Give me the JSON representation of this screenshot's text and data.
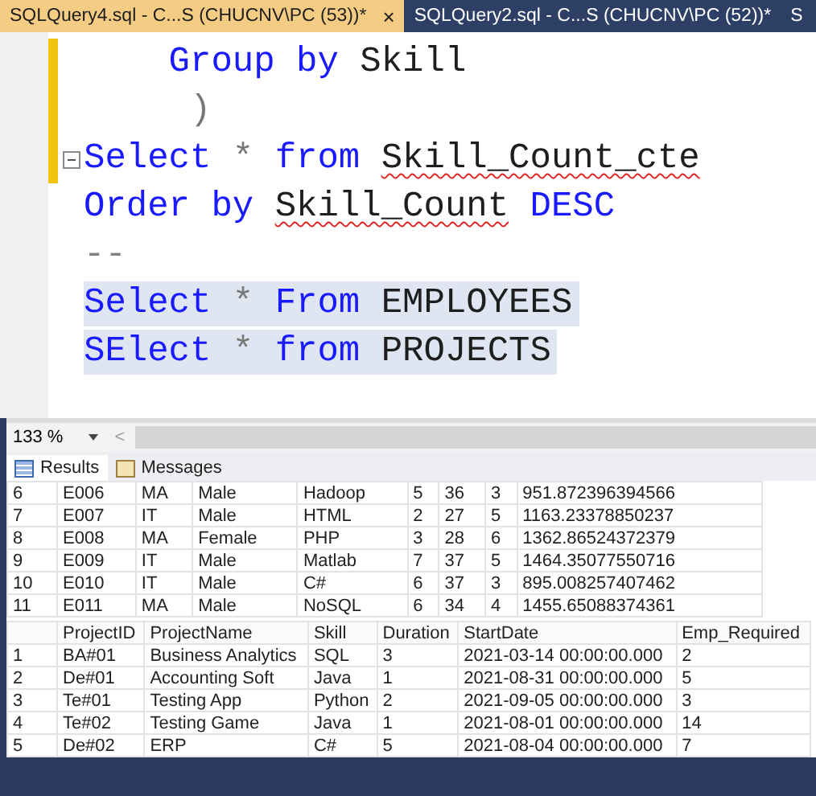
{
  "tabs": [
    {
      "label": "SQLQuery4.sql - C...S (CHUCNV\\PC (53))*",
      "selected": true,
      "close": "×"
    },
    {
      "label": "SQLQuery2.sql - C...S (CHUCNV\\PC (52))*",
      "selected": false
    },
    {
      "label": "S",
      "selected": false
    }
  ],
  "editor": {
    "lines": [
      {
        "selected": false,
        "collapsible": false,
        "tokens": [
          {
            "kind": "keyword",
            "text": "    Group by"
          },
          {
            "kind": "plain",
            "text": " Skill"
          }
        ]
      },
      {
        "selected": false,
        "collapsible": false,
        "tokens": [
          {
            "kind": "operator",
            "text": "     )"
          }
        ]
      },
      {
        "selected": false,
        "collapsible": true,
        "tokens": [
          {
            "kind": "keyword",
            "text": "Select"
          },
          {
            "kind": "operator",
            "text": " * "
          },
          {
            "kind": "keyword",
            "text": "from "
          },
          {
            "kind": "plain",
            "text": "Skill_Count_cte",
            "error": true
          }
        ]
      },
      {
        "selected": false,
        "collapsible": false,
        "tokens": [
          {
            "kind": "keyword",
            "text": "Order by "
          },
          {
            "kind": "plain",
            "text": "Skill_Count",
            "error": true
          },
          {
            "kind": "keyword",
            "text": " DESC"
          }
        ]
      },
      {
        "selected": false,
        "collapsible": false,
        "tokens": [
          {
            "kind": "comment",
            "text": "--"
          }
        ]
      },
      {
        "selected": true,
        "collapsible": false,
        "tokens": [
          {
            "kind": "keyword",
            "text": "Select"
          },
          {
            "kind": "operator",
            "text": " * "
          },
          {
            "kind": "keyword",
            "text": "From"
          },
          {
            "kind": "plain",
            "text": " EMPLOYEES"
          }
        ]
      },
      {
        "selected": true,
        "collapsible": false,
        "tokens": [
          {
            "kind": "keyword",
            "text": "SElect"
          },
          {
            "kind": "operator",
            "text": " * "
          },
          {
            "kind": "keyword",
            "text": "from"
          },
          {
            "kind": "plain",
            "text": " PROJECTS"
          }
        ]
      }
    ]
  },
  "zoom": {
    "value": "133 %",
    "scroll_left": "<"
  },
  "result_tabs": [
    {
      "label": "Results",
      "kind": "grid",
      "selected": true
    },
    {
      "label": "Messages",
      "kind": "messages",
      "selected": false
    }
  ],
  "grids": [
    {
      "rows": [
        [
          "6",
          "E006",
          "MA",
          "Male",
          "Hadoop",
          "5",
          "36",
          "3",
          "951.872396394566"
        ],
        [
          "7",
          "E007",
          "IT",
          "Male",
          "HTML",
          "2",
          "27",
          "5",
          "1163.23378850237"
        ],
        [
          "8",
          "E008",
          "MA",
          "Female",
          "PHP",
          "3",
          "28",
          "6",
          "1362.86524372379"
        ],
        [
          "9",
          "E009",
          "IT",
          "Male",
          "Matlab",
          "7",
          "37",
          "5",
          "1464.35077550716"
        ],
        [
          "10",
          "E010",
          "IT",
          "Male",
          "C#",
          "6",
          "37",
          "3",
          "895.008257407462"
        ],
        [
          "11",
          "E011",
          "MA",
          "Male",
          "NoSQL",
          "6",
          "34",
          "4",
          "1455.65088374361"
        ]
      ]
    },
    {
      "columns": [
        "",
        "ProjectID",
        "ProjectName",
        "Skill",
        "Duration",
        "StartDate",
        "Emp_Required"
      ],
      "rows": [
        [
          "1",
          "BA#01",
          "Business Analytics",
          "SQL",
          "3",
          "2021-03-14 00:00:00.000",
          "2"
        ],
        [
          "2",
          "De#01",
          "Accounting Soft",
          "Java",
          "1",
          "2021-08-31 00:00:00.000",
          "5"
        ],
        [
          "3",
          "Te#01",
          "Testing App",
          "Python",
          "2",
          "2021-09-05 00:00:00.000",
          "3"
        ],
        [
          "4",
          "Te#02",
          "Testing Game",
          "Java",
          "1",
          "2021-08-01 00:00:00.000",
          "14"
        ],
        [
          "5",
          "De#02",
          "ERP",
          "C#",
          "5",
          "2021-08-04 00:00:00.000",
          "7"
        ]
      ]
    }
  ]
}
